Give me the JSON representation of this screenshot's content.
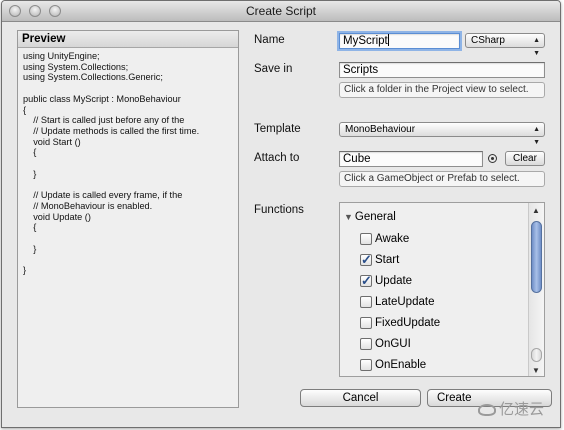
{
  "window": {
    "title": "Create Script"
  },
  "preview": {
    "title": "Preview",
    "code": "using UnityEngine;\nusing System.Collections;\nusing System.Collections.Generic;\n\npublic class MyScript : MonoBehaviour\n{\n    // Start is called just before any of the\n    // Update methods is called the first time.\n    void Start ()\n    {\n\n    }\n\n    // Update is called every frame, if the\n    // MonoBehaviour is enabled.\n    void Update ()\n    {\n\n    }\n\n}"
  },
  "form": {
    "name_label": "Name",
    "name_value": "MyScript",
    "language": "CSharp",
    "save_in_label": "Save in",
    "save_in_value": "Scripts",
    "save_in_help": "Click a folder in the Project view to select.",
    "template_label": "Template",
    "template_value": "MonoBehaviour",
    "attach_label": "Attach to",
    "attach_value": "Cube",
    "clear_label": "Clear",
    "attach_help": "Click a GameObject or Prefab to select.",
    "functions_label": "Functions"
  },
  "functions": {
    "group": "General",
    "items": [
      {
        "label": "Awake",
        "checked": false
      },
      {
        "label": "Start",
        "checked": true
      },
      {
        "label": "Update",
        "checked": true
      },
      {
        "label": "LateUpdate",
        "checked": false
      },
      {
        "label": "FixedUpdate",
        "checked": false
      },
      {
        "label": "OnGUI",
        "checked": false
      },
      {
        "label": "OnEnable",
        "checked": false
      }
    ]
  },
  "buttons": {
    "cancel": "Cancel",
    "create": "Create"
  },
  "watermark": "亿速云",
  "colors": {
    "accent": "#2a4f8a",
    "focus_ring": "#8fb4e6"
  }
}
